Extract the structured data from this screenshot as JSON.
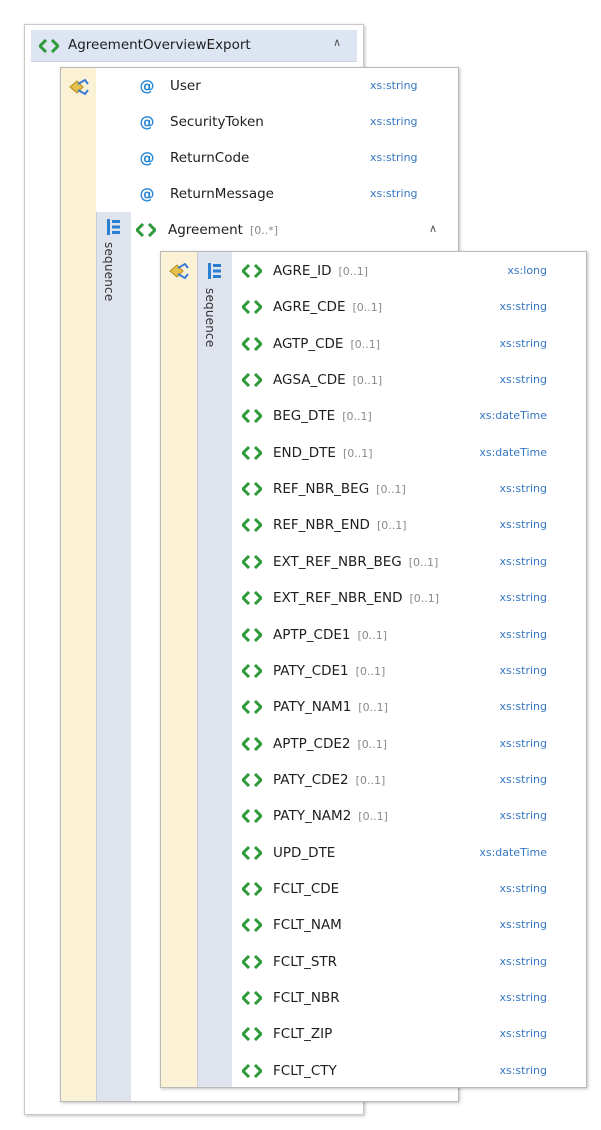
{
  "root": {
    "name": "AgreementOverviewExport"
  },
  "outer": {
    "attributes": [
      {
        "name": "User",
        "type": "xs:string"
      },
      {
        "name": "SecurityToken",
        "type": "xs:string"
      },
      {
        "name": "ReturnCode",
        "type": "xs:string"
      },
      {
        "name": "ReturnMessage",
        "type": "xs:string"
      }
    ],
    "sequence_label": "sequence",
    "agreement": {
      "name": "Agreement",
      "cardinality": "[0..*]"
    }
  },
  "inner": {
    "sequence_label": "sequence",
    "elements": [
      {
        "name": "AGRE_ID",
        "card": "[0..1]",
        "type": "xs:long"
      },
      {
        "name": "AGRE_CDE",
        "card": "[0..1]",
        "type": "xs:string"
      },
      {
        "name": "AGTP_CDE",
        "card": "[0..1]",
        "type": "xs:string"
      },
      {
        "name": "AGSA_CDE",
        "card": "[0..1]",
        "type": "xs:string"
      },
      {
        "name": "BEG_DTE",
        "card": "[0..1]",
        "type": "xs:dateTime"
      },
      {
        "name": "END_DTE",
        "card": "[0..1]",
        "type": "xs:dateTime"
      },
      {
        "name": "REF_NBR_BEG",
        "card": "[0..1]",
        "type": "xs:string"
      },
      {
        "name": "REF_NBR_END",
        "card": "[0..1]",
        "type": "xs:string"
      },
      {
        "name": "EXT_REF_NBR_BEG",
        "card": "[0..1]",
        "type": "xs:string"
      },
      {
        "name": "EXT_REF_NBR_END",
        "card": "[0..1]",
        "type": "xs:string"
      },
      {
        "name": "APTP_CDE1",
        "card": "[0..1]",
        "type": "xs:string"
      },
      {
        "name": "PATY_CDE1",
        "card": "[0..1]",
        "type": "xs:string"
      },
      {
        "name": "PATY_NAM1",
        "card": "[0..1]",
        "type": "xs:string"
      },
      {
        "name": "APTP_CDE2",
        "card": "[0..1]",
        "type": "xs:string"
      },
      {
        "name": "PATY_CDE2",
        "card": "[0..1]",
        "type": "xs:string"
      },
      {
        "name": "PATY_NAM2",
        "card": "[0..1]",
        "type": "xs:string"
      },
      {
        "name": "UPD_DTE",
        "card": "",
        "type": "xs:dateTime"
      },
      {
        "name": "FCLT_CDE",
        "card": "",
        "type": "xs:string"
      },
      {
        "name": "FCLT_NAM",
        "card": "",
        "type": "xs:string"
      },
      {
        "name": "FCLT_STR",
        "card": "",
        "type": "xs:string"
      },
      {
        "name": "FCLT_NBR",
        "card": "",
        "type": "xs:string"
      },
      {
        "name": "FCLT_ZIP",
        "card": "",
        "type": "xs:string"
      },
      {
        "name": "FCLT_CTY",
        "card": "",
        "type": "xs:string"
      }
    ]
  },
  "colors": {
    "header_bg": "#dde5f3",
    "attr_strip": "#fbf2d6",
    "seq_strip": "#dfe3ee",
    "element_icon": "#2f9a3a",
    "type_text": "#3677c2",
    "attr_icon": "#2786d6"
  },
  "icons": {
    "element": "element-icon",
    "attribute": "attribute-icon",
    "attributes_group": "attributes-group-icon",
    "sequence": "sequence-icon",
    "collapse": "collapse-chevron-icon"
  }
}
